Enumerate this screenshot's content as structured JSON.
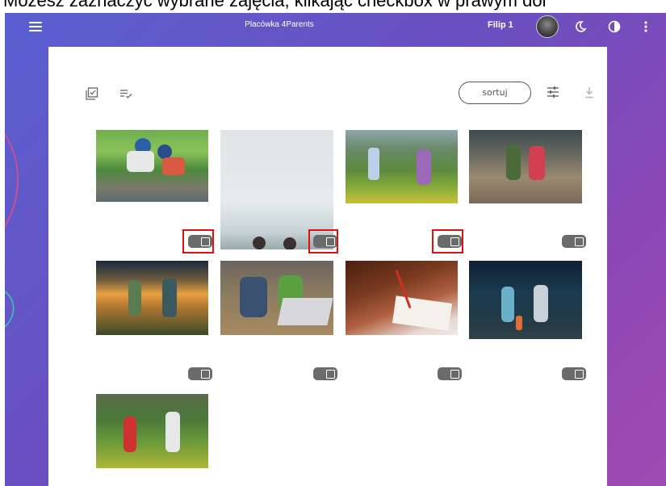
{
  "caption": "Możesz zaznaczyć wybrane zajęcia, klikając checkbox w prawym dol",
  "topbar": {
    "title": "Placówka 4Parents",
    "user_name": "Filip 1",
    "icons": [
      "menu-icon",
      "avatar",
      "moon-icon",
      "contrast-icon",
      "more-vert-icon"
    ]
  },
  "toolbar": {
    "select_all_icon": "checkbox-icon",
    "list_check_icon": "playlist-check-icon",
    "sort_label": "sortuj",
    "filter_icon": "tune-icon",
    "download_icon": "download-icon"
  },
  "gallery": {
    "photos": [
      {
        "name": "photo-kids-stream",
        "highlighted": true
      },
      {
        "name": "photo-sky-kids",
        "highlighted": true
      },
      {
        "name": "photo-kids-telescope",
        "highlighted": true
      },
      {
        "name": "photo-two-girls-path",
        "highlighted": false
      },
      {
        "name": "photo-kids-sunset",
        "highlighted": false
      },
      {
        "name": "photo-kids-laptop",
        "highlighted": false
      },
      {
        "name": "photo-child-writing",
        "highlighted": false
      },
      {
        "name": "photo-kids-dark-forest",
        "highlighted": false
      },
      {
        "name": "photo-kids-meadow",
        "highlighted": false
      }
    ]
  },
  "colors": {
    "highlight": "#e01010",
    "toggle": "#6b6b6b",
    "gradient_start": "#5a5fd0",
    "gradient_end": "#a04bb0"
  }
}
